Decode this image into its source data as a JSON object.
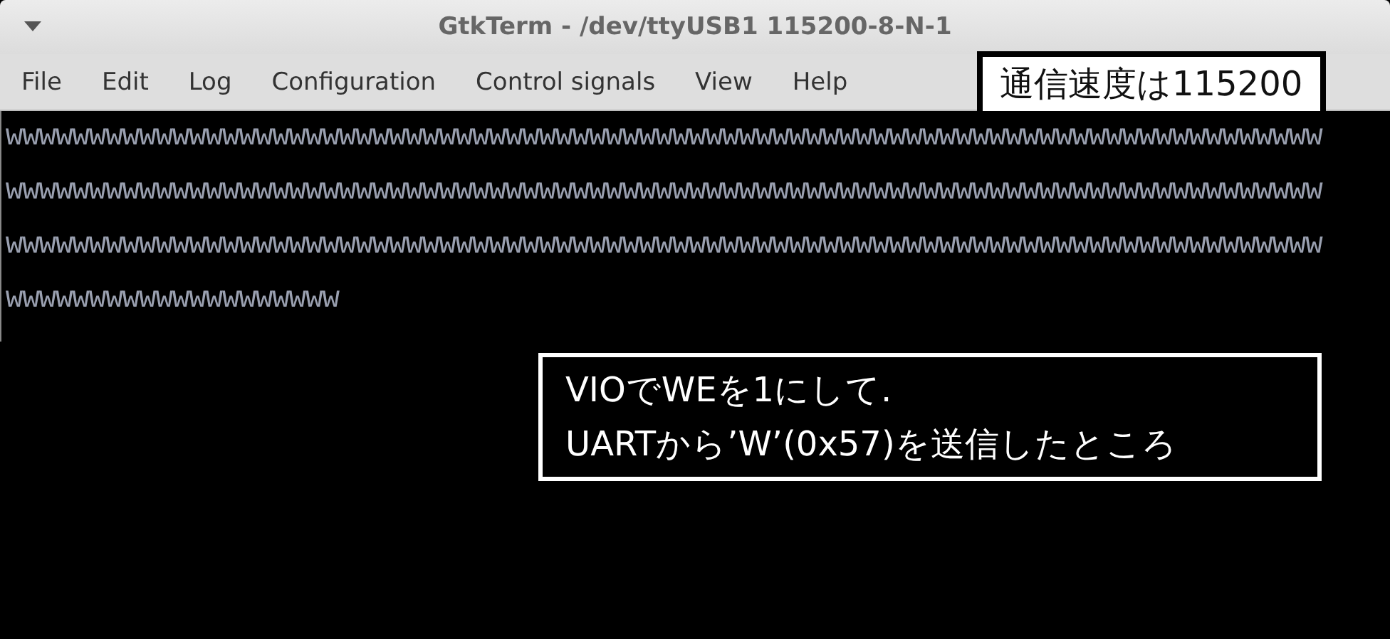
{
  "window": {
    "title": "GtkTerm - /dev/ttyUSB1  115200-8-N-1"
  },
  "menu": [
    "File",
    "Edit",
    "Log",
    "Configuration",
    "Control signals",
    "View",
    "Help"
  ],
  "terminal": {
    "lines": [
      "WWWWWWWWWWWWWWWWWWWWWWWWWWWWWWWWWWWWWWWWWWWWWWWWWWWWWWWWWWWWWWWWWWWWWWWWWWWWWWW",
      "WWWWWWWWWWWWWWWWWWWWWWWWWWWWWWWWWWWWWWWWWWWWWWWWWWWWWWWWWWWWWWWWWWWWWWWWWWWWWWW",
      "WWWWWWWWWWWWWWWWWWWWWWWWWWWWWWWWWWWWWWWWWWWWWWWWWWWWWWWWWWWWWWWWWWWWWWWWWWWWWWW",
      "WWWWWWWWWWWWWWWWWWWW"
    ]
  },
  "callouts": [
    {
      "kind": "light",
      "lines": [
        "通信速度は115200"
      ]
    },
    {
      "kind": "dark",
      "lines": [
        "VIOでWEを1にして.",
        "UARTから’W’(0x57)を送信したところ"
      ]
    }
  ]
}
